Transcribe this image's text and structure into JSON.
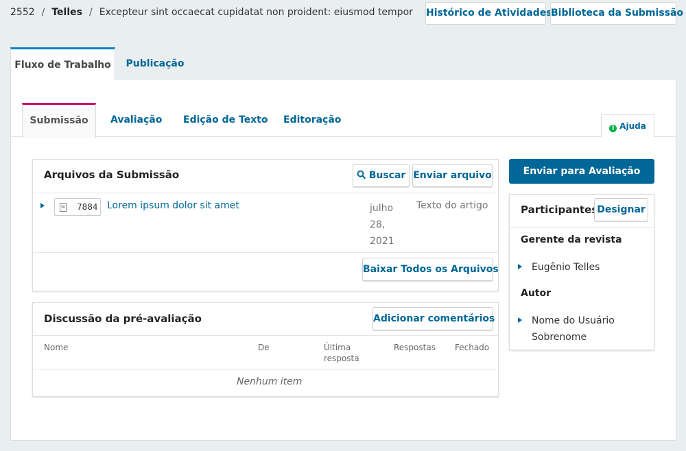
{
  "header": {
    "submission_id": "2552",
    "author_last": "Telles",
    "title": "Excepteur sint occaecat cupidatat non proident: eiusmod tempor incididunt",
    "separator": "/",
    "activity_button": "Histórico de Atividades",
    "library_button": "Biblioteca da Submissão"
  },
  "top_tabs": {
    "workflow": "Fluxo de Trabalho",
    "publication": "Publicação"
  },
  "stage_tabs": [
    "Submissão",
    "Avaliação",
    "Edição de Texto",
    "Editoração"
  ],
  "help": {
    "icon_glyph": "i",
    "label": "Ajuda"
  },
  "files": {
    "title": "Arquivos da Submissão",
    "search_button": "Buscar",
    "upload_button": "Enviar arquivo",
    "file": {
      "id": "7884",
      "name": "Lorem ipsum dolor sit amet",
      "date_lines": [
        "julho",
        "28,",
        "2021"
      ],
      "type": "Texto do artigo"
    },
    "download_all_button": "Baixar Todos os Arquivos"
  },
  "discussion": {
    "title": "Discussão da pré-avaliação",
    "add_button": "Adicionar comentários",
    "columns": {
      "name": "Nome",
      "from": "De",
      "last_reply_1": "Última",
      "last_reply_2": "resposta",
      "replies": "Respostas",
      "closed": "Fechado"
    },
    "empty": "Nenhum item"
  },
  "sidebar": {
    "primary_button": "Enviar para Avaliação",
    "participants_title": "Participantes",
    "assign_button": "Designar",
    "groups": [
      {
        "role": "Gerente da revista",
        "people": [
          "Eugênio Telles"
        ]
      },
      {
        "role": "Autor",
        "people": [
          "Nome do Usuário Sobrenome"
        ]
      }
    ]
  },
  "colors": {
    "link": "#006798",
    "primary": "#006798",
    "active_top_tab": "#0a82c2",
    "active_stage_tab": "#d00a6c",
    "help_icon": "#00b24e"
  }
}
